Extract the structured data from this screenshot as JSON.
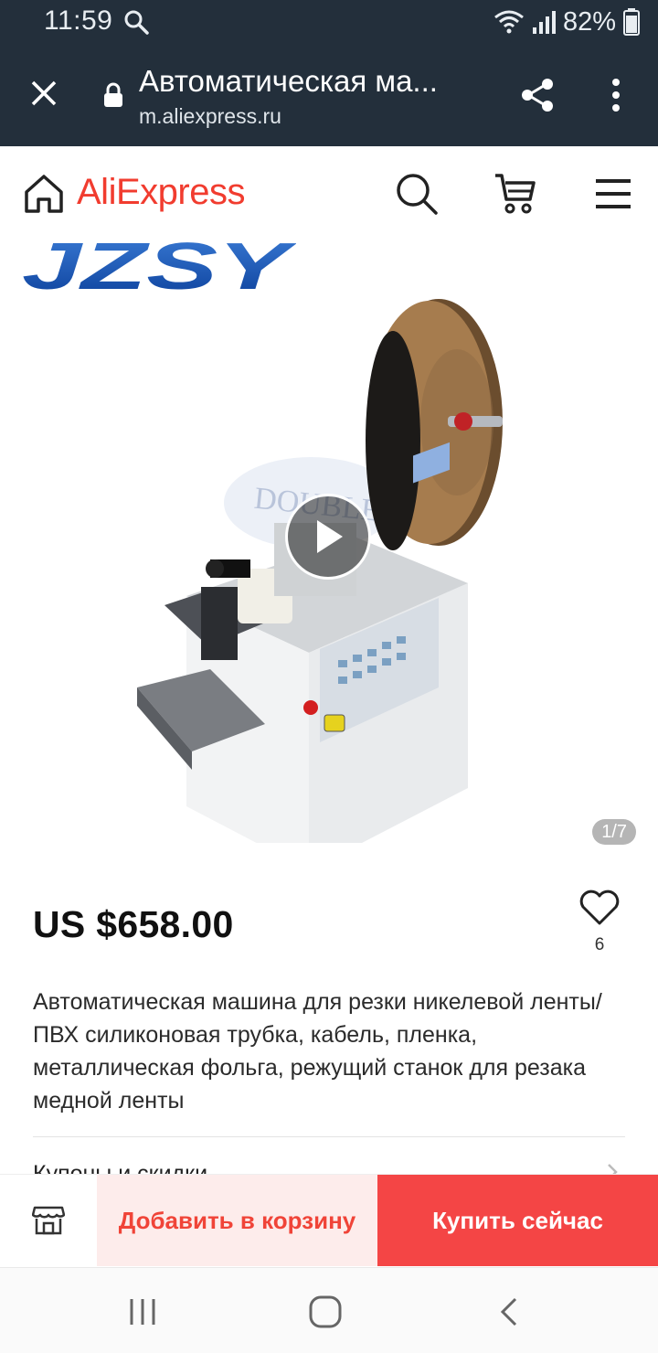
{
  "status_bar": {
    "time": "11:59",
    "battery_pct": "82%",
    "icons": [
      "search-icon",
      "wifi-icon",
      "signal-icon",
      "battery-icon"
    ]
  },
  "browser": {
    "page_title": "Автоматическая ма...",
    "url": "m.aliexpress.ru",
    "icons": [
      "close-icon",
      "lock-icon",
      "share-icon",
      "more-vert-icon"
    ]
  },
  "header": {
    "logo_text": "AliExpress",
    "icons": [
      "home-icon",
      "search-icon",
      "cart-icon",
      "menu-icon"
    ],
    "logo_color": "#f13c2f"
  },
  "gallery": {
    "brand_text": "JZSY",
    "counter": "1/7",
    "watermark": "DOUBLE",
    "icons": [
      "play-icon"
    ]
  },
  "product": {
    "price": "US $658.00",
    "wishlist_count": "6",
    "title": "Автоматическая машина для резки никелевой ленты/ПВХ силиконовая трубка, кабель, пленка, металлическая фольга, режущий станок для резака медной ленты",
    "section_peek": "Купоны и скидки"
  },
  "actions": {
    "add_to_cart": "Добавить в корзину",
    "buy_now": "Купить сейчас",
    "icons": [
      "store-icon"
    ],
    "accent_color": "#f44545"
  },
  "system_nav": {
    "icons": [
      "recent-apps-icon",
      "home-circle-icon",
      "back-icon"
    ]
  }
}
